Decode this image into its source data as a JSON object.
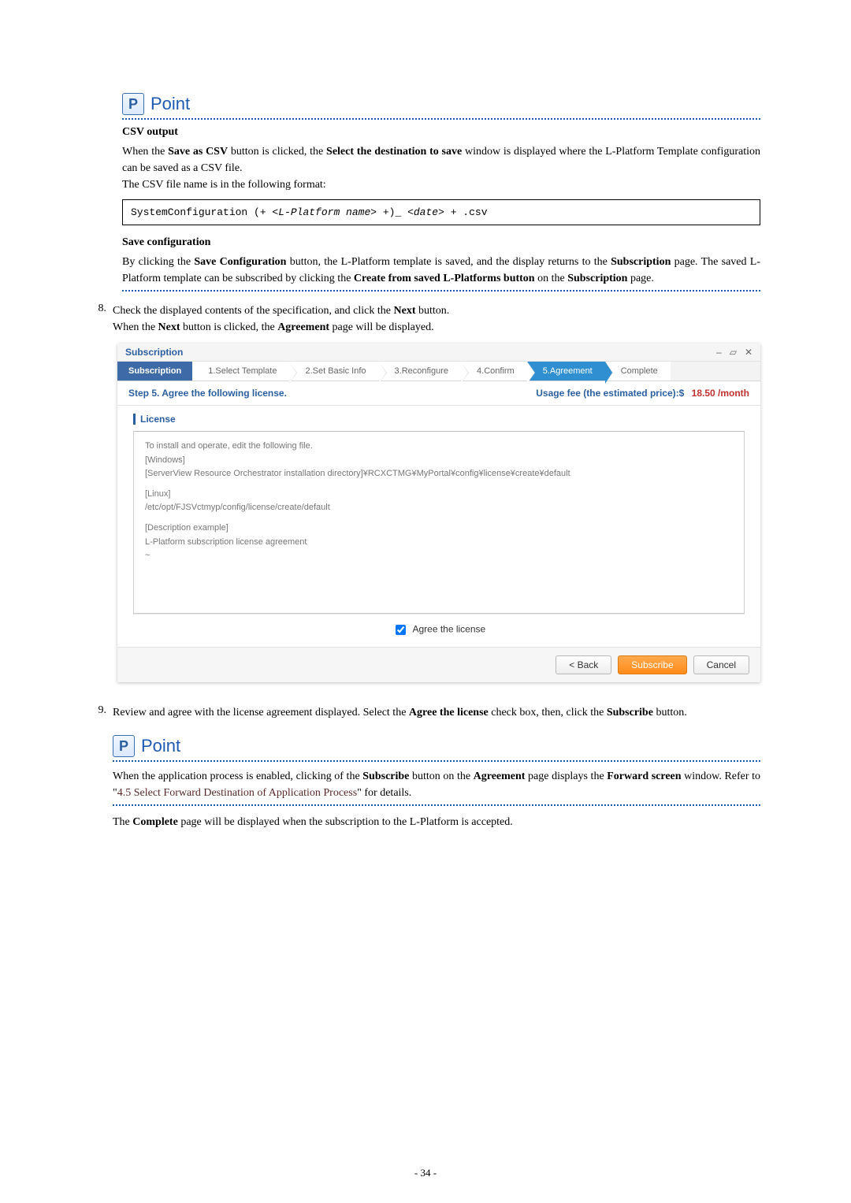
{
  "point1": {
    "label": "Point",
    "badge": "P",
    "heading_csv": "CSV output",
    "csv_p1_a": "When the ",
    "csv_p1_b": "Save as CSV",
    "csv_p1_c": " button is clicked, the ",
    "csv_p1_d": "Select the destination to save",
    "csv_p1_e": " window is displayed where the L-Platform Template configuration can be saved as a CSV file.",
    "csv_p2": "The CSV file name is in the following format:",
    "code_a": "SystemConfiguration (+ <",
    "code_b": "L-Platform name",
    "code_c": "> +)_ <",
    "code_d": "date",
    "code_e": "> + .csv",
    "heading_save": "Save configuration",
    "save_p_a": "By clicking the ",
    "save_p_b": "Save Configuration",
    "save_p_c": " button, the L-Platform template is saved, and the display returns to the ",
    "save_p_d": "Subscription",
    "save_p_e": " page. The saved L-Platform template can be subscribed by clicking the ",
    "save_p_f": "Create from saved L-Platforms button",
    "save_p_g": " on the ",
    "save_p_h": "Subscription",
    "save_p_i": " page."
  },
  "step8": {
    "num": "8.",
    "line1_a": "Check the displayed contents of the specification, and click the ",
    "line1_b": "Next",
    "line1_c": " button.",
    "line2_a": "When the ",
    "line2_b": "Next",
    "line2_c": " button is clicked, the ",
    "line2_d": "Agreement",
    "line2_e": " page will be displayed."
  },
  "screenshot": {
    "window_title": "Subscription",
    "winctl_min": "–",
    "winctl_max": "▱",
    "winctl_close": "✕",
    "tab_main": "Subscription",
    "tabs": {
      "t1": "1.Select Template",
      "t2": "2.Set Basic Info",
      "t3": "3.Reconfigure",
      "t4": "4.Confirm",
      "t5": "5.Agreement",
      "t6": "Complete"
    },
    "step_label": "Step 5. Agree the following license.",
    "usage_label": "Usage fee (the estimated price):$",
    "usage_value": "18.50 /month",
    "lic_header": "License",
    "lic_l1": "To install and operate, edit the following file.",
    "lic_l2": "[Windows]",
    "lic_l3": "[ServerView Resource Orchestrator installation directory]¥RCXCTMG¥MyPortal¥config¥license¥create¥default",
    "lic_l4": "[Linux]",
    "lic_l5": "/etc/opt/FJSVctmyp/config/license/create/default",
    "lic_l6": "[Description example]",
    "lic_l7": "L-Platform subscription license agreement",
    "lic_l8": "~",
    "agree_label": "Agree the license",
    "btn_back": "< Back",
    "btn_subscribe": "Subscribe",
    "btn_cancel": "Cancel"
  },
  "step9": {
    "num": "9.",
    "a": "Review and agree with the license agreement displayed. Select the ",
    "b": "Agree the license",
    "c": " check box, then, click the ",
    "d": "Subscribe",
    "e": " button."
  },
  "point2": {
    "label": "Point",
    "badge": "P",
    "a": "When the application process is enabled, clicking of the ",
    "b": "Subscribe",
    "c": " button on the ",
    "d": "Agreement",
    "e": " page displays the ",
    "f": "Forward screen",
    "g": " window. Refer to \"",
    "link": "4.5 Select Forward Destination of Application Process",
    "h": "\" for details."
  },
  "tail": {
    "a": "The ",
    "b": "Complete",
    "c": " page will be displayed when the subscription to the L-Platform is accepted."
  },
  "page_number": "- 34 -"
}
